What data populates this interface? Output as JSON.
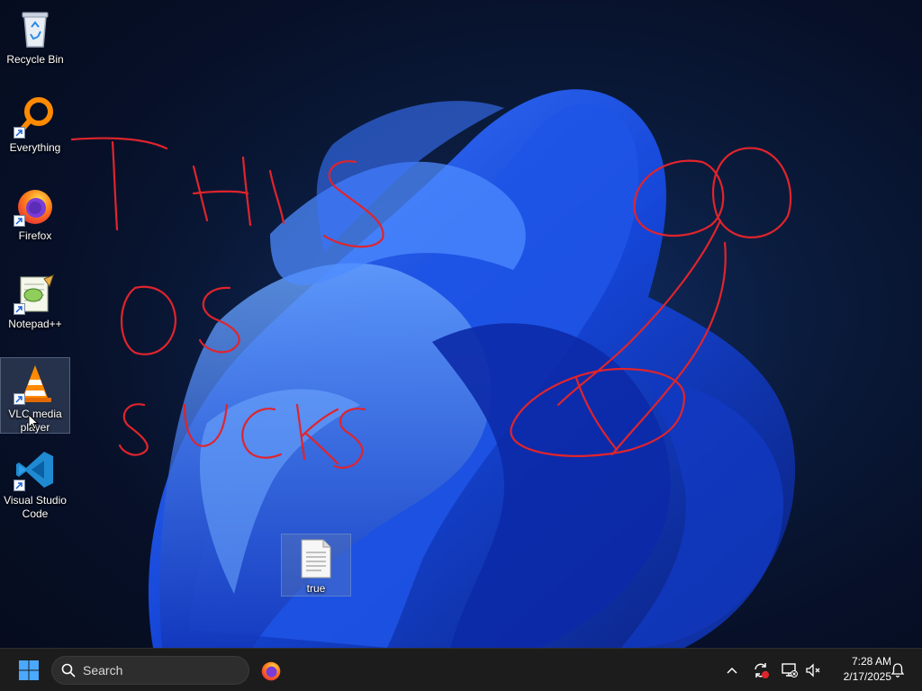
{
  "desktop": {
    "icons": [
      {
        "label": "Recycle Bin",
        "icon": "recycle-bin-icon"
      },
      {
        "label": "Everything",
        "icon": "everything-search-icon"
      },
      {
        "label": "Firefox",
        "icon": "firefox-icon"
      },
      {
        "label": "Notepad++",
        "icon": "notepad-plus-plus-icon"
      },
      {
        "label": "VLC media player",
        "icon": "vlc-icon"
      },
      {
        "label": "Visual Studio Code",
        "icon": "vscode-icon"
      },
      {
        "label": "true",
        "icon": "text-file-icon"
      }
    ],
    "scribble_color": "#e0242c"
  },
  "taskbar": {
    "search_placeholder": "Search",
    "clock": {
      "time": "7:28 AM",
      "date": "2/17/2025"
    },
    "accent": "#4aa8ff"
  }
}
